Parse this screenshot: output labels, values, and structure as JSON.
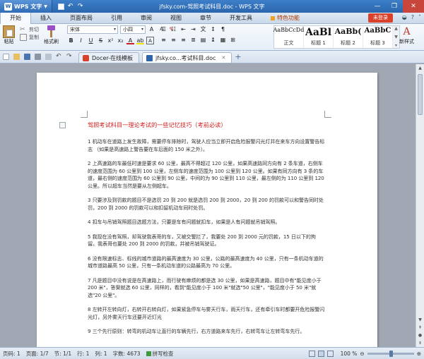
{
  "window": {
    "title": "jfsky.com-驾照考试科目.doc - WPS 文字",
    "app_button": "WPS 文字"
  },
  "menu": {
    "tabs": [
      "开始",
      "插入",
      "页面布局",
      "引用",
      "审阅",
      "视图",
      "章节",
      "开发工具"
    ],
    "special_tab": "特色功能",
    "login": "未登录"
  },
  "ribbon": {
    "paste": "粘贴",
    "cut": "剪切",
    "copy": "复制",
    "format_painter": "格式刷",
    "font": "宋体",
    "size": "小四",
    "styles": [
      {
        "sample": "AaBbCcDd",
        "name": "正文"
      },
      {
        "sample": "AaBl",
        "name": "标题 1"
      },
      {
        "sample": "AaBb(",
        "name": "标题 2"
      },
      {
        "sample": "AaBbC",
        "name": "标题 3"
      }
    ],
    "new_style": "新样式"
  },
  "doc_tabs": [
    {
      "label": "Docer-在线模板",
      "active": false
    },
    {
      "label": "jfsky.co...考试科目.doc",
      "active": true
    }
  ],
  "document": {
    "title": "驾照考试科目一理论考试的一些记忆技巧（考前必读）",
    "paragraphs": [
      "1 机动车在道路上发生故障，需要停车排除时，驾驶人应当立即开启危险报警闪光灯并在来车方向设置警告标志 （如果是高速路上警告要在车后面的 150 米之外）。",
      "2 上高速路的车最低时速是要求 60 公里，最高不得超过 120 公里，如果高速路同方向有 2 条车道，右侧车的速度范围为 60 公里到 100 公里，左侧车的速度范围为 100 公里到 120 公里。如果有同方向有 3 条的车道，最右侧的速度范围为 60 公里到 90 公里，中间的为 90 公里到 110 公里，最左侧的为 110 公里到 120 公里。所以超车当然是要从左侧超车。",
      "3 只要涉及到罚款的题目不是选罚 20 到 200 就是选罚 200 到 2000，20 到 200 的罚款可以和警告同时处罚，200 到 2000 的罚款可以和扣留机动车同时处罚。",
      "4 扣车与吊销驾照题目选题方法，只要是车有问题就扣车，如果是人有问题就吊销驾照。",
      "5 我现在没有驾照，却驾驶我表哥的车，又被交警拦了，我要处 200 到 2000 元的罚款，15 日以下的拘留。我表哥也要处 200 到 2000 的罚款，并被吊销驾驶证。",
      "6 没有限速标志、标线的城市道路的最高速度为 30 公里，公路的最高速度为 40 公里，只有一条机动车道的城市道路最高 50 公里，只有一条机动车道的公路最高为 70 公里。",
      "7 凡是题目中没有说是在高速路上，而行驶有麻烦的都是选 30 公里，如果是高速路，题目中有\"能见度小于 200 米\"，答案就选 60 公里，同样的，看到\"能见度小于 100 米\"就选\"50 公里\"，\"能见度小于 50 米\"就选\"20 公里\"。",
      "8 左转开左转向灯，右转开右转向灯，如果紧急停车与雾天行车，雨天行车，还有牵引车时都要开危险报警闪光灯，另外雾天行车还要开近灯光",
      "9 三个先行原则：转弯的机动车让直行的车辆先行，右方道路来车先行，右转弯车让左转弯车先行。"
    ]
  },
  "status": {
    "page": "页码: 1",
    "pages": "页面: 1/7",
    "section": "节: 1/1",
    "row": "行: 1",
    "col": "列: 1",
    "words": "字数: 4673",
    "spell": "拼写检查",
    "zoom": "100 %",
    "zoom_level": 0.5
  },
  "colors": {
    "accent": "#2b66ad",
    "title_red": "#d11f1f",
    "login_red": "#d9412b"
  }
}
